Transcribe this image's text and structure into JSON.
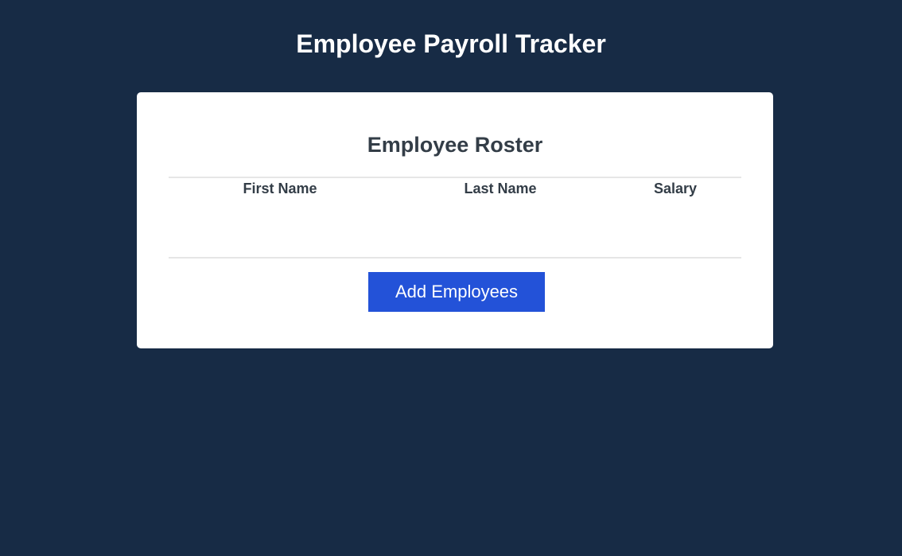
{
  "app": {
    "title": "Employee Payroll Tracker"
  },
  "roster": {
    "title": "Employee Roster",
    "columns": [
      "First Name",
      "Last Name",
      "Salary"
    ],
    "rows": [],
    "add_button_label": "Add Employees"
  },
  "colors": {
    "background": "#172b45",
    "card": "#ffffff",
    "heading_text": "#333d47",
    "button_accent": "#2352d8"
  }
}
